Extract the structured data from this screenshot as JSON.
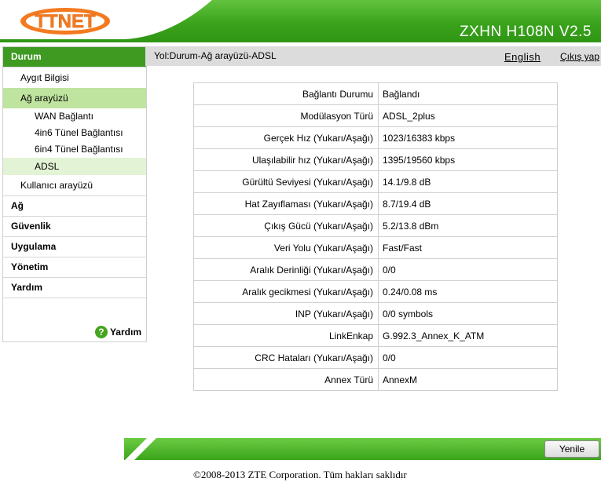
{
  "header": {
    "logo_text": "TTNET",
    "model": "ZXHN H108N V2.5"
  },
  "sidebar": {
    "menu": [
      {
        "label": "Durum"
      },
      {
        "label": "Aygıt Bilgisi"
      },
      {
        "label": "Ağ arayüzü"
      },
      {
        "label": "WAN Bağlantı"
      },
      {
        "label": "4in6 Tünel Bağlantısı"
      },
      {
        "label": "6in4 Tünel Bağlantısı"
      },
      {
        "label": "ADSL"
      },
      {
        "label": "Kullanıcı arayüzü"
      },
      {
        "label": "Ağ"
      },
      {
        "label": "Güvenlik"
      },
      {
        "label": "Uygulama"
      },
      {
        "label": "Yönetim"
      },
      {
        "label": "Yardım"
      }
    ],
    "help_label": "Yardım",
    "help_icon": "?"
  },
  "topbar": {
    "breadcrumb": "Yol:Durum-Ağ arayüzü-ADSL",
    "english": "English",
    "logout": "Çıkış yap"
  },
  "adsl": {
    "rows": [
      {
        "label": "Bağlantı Durumu",
        "value": "Bağlandı"
      },
      {
        "label": "Modülasyon Türü",
        "value": "ADSL_2plus"
      },
      {
        "label": "Gerçek Hız (Yukarı/Aşağı)",
        "value": "1023/16383 kbps"
      },
      {
        "label": "Ulaşılabilir hız (Yukarı/Aşağı)",
        "value": "1395/19560 kbps"
      },
      {
        "label": "Gürültü Seviyesi (Yukarı/Aşağı)",
        "value": "14.1/9.8 dB"
      },
      {
        "label": "Hat Zayıflaması (Yukarı/Aşağı)",
        "value": "8.7/19.4 dB"
      },
      {
        "label": "Çıkış Gücü (Yukarı/Aşağı)",
        "value": "5.2/13.8 dBm"
      },
      {
        "label": "Veri Yolu (Yukarı/Aşağı)",
        "value": "Fast/Fast"
      },
      {
        "label": "Aralık Derinliği (Yukarı/Aşağı)",
        "value": "0/0"
      },
      {
        "label": "Aralık gecikmesi (Yukarı/Aşağı)",
        "value": "0.24/0.08 ms"
      },
      {
        "label": "INP (Yukarı/Aşağı)",
        "value": "0/0 symbols"
      },
      {
        "label": "LinkEnkap",
        "value": "G.992.3_Annex_K_ATM"
      },
      {
        "label": "CRC Hataları (Yukarı/Aşağı)",
        "value": "0/0"
      },
      {
        "label": "Annex Türü",
        "value": "AnnexM"
      }
    ]
  },
  "footer": {
    "refresh": "Yenile",
    "copyright": "©2008-2013 ZTE Corporation. Tüm hakları saklıdır"
  },
  "colors": {
    "brand_green": "#3f9a22",
    "logo_orange": "#f47a20",
    "active_sub": "#bfe49f"
  }
}
